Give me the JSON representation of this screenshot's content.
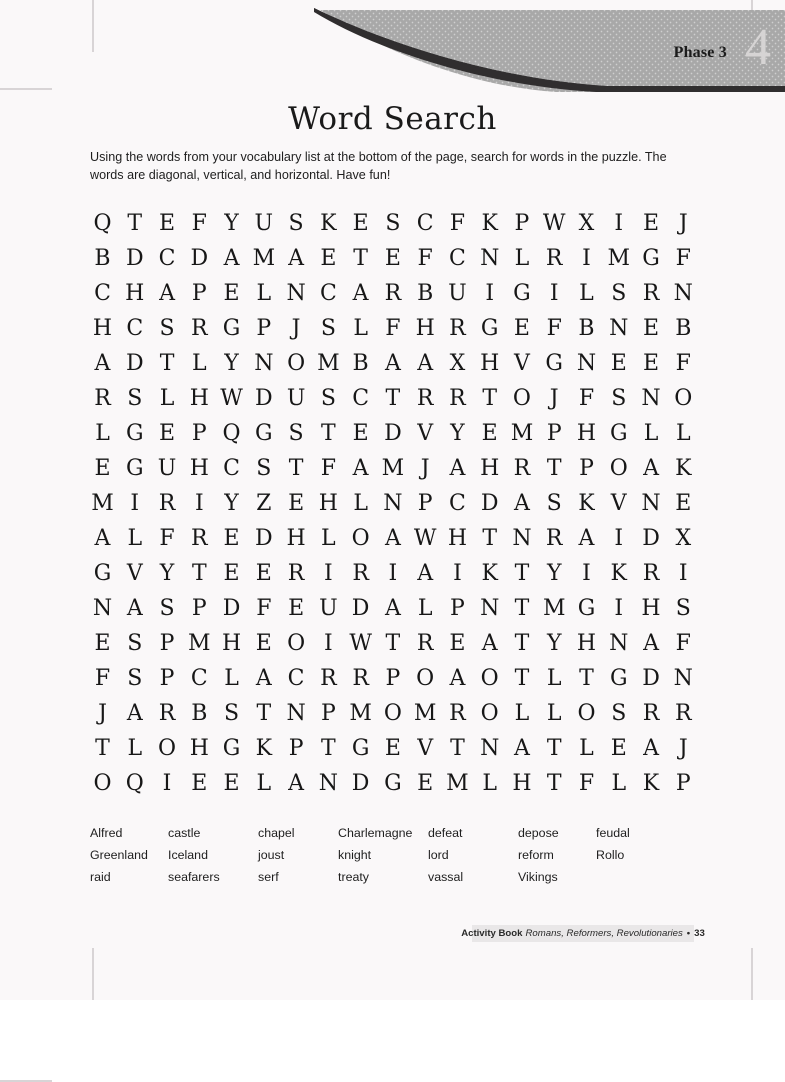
{
  "header": {
    "phase_label": "Phase 3",
    "phase_number": "4",
    "banner_gray": "#a8a8a8",
    "banner_dark": "#302e2f"
  },
  "page": {
    "title": "Word Search",
    "instructions": "Using the words from your vocabulary list at the bottom of the page, search for words in the puzzle. The words are diagonal, vertical, and horizontal. Have fun!"
  },
  "puzzle": {
    "columns": 19,
    "rows": 18,
    "grid": [
      [
        "Q",
        "T",
        "E",
        "F",
        "Y",
        "U",
        "S",
        "K",
        "E",
        "S",
        "C",
        "F",
        "K",
        "P",
        "W",
        "X",
        "I",
        "E",
        "J"
      ],
      [
        "B",
        "D",
        "C",
        "D",
        "A",
        "M",
        "A",
        "E",
        "T",
        "E",
        "F",
        "C",
        "N",
        "L",
        "R",
        "I",
        "M",
        "G",
        "F"
      ],
      [
        "C",
        "H",
        "A",
        "P",
        "E",
        "L",
        "N",
        "C",
        "A",
        "R",
        "B",
        "U",
        "I",
        "G",
        "I",
        "L",
        "S",
        "R",
        "N"
      ],
      [
        "H",
        "C",
        "S",
        "R",
        "G",
        "P",
        "J",
        "S",
        "L",
        "F",
        "H",
        "R",
        "G",
        "E",
        "F",
        "B",
        "N",
        "E",
        "B"
      ],
      [
        "A",
        "D",
        "T",
        "L",
        "Y",
        "N",
        "O",
        "M",
        "B",
        "A",
        "A",
        "X",
        "H",
        "V",
        "G",
        "N",
        "E",
        "E",
        "F"
      ],
      [
        "R",
        "S",
        "L",
        "H",
        "W",
        "D",
        "U",
        "S",
        "C",
        "T",
        "R",
        "R",
        "T",
        "O",
        "J",
        "F",
        "S",
        "N",
        "O"
      ],
      [
        "L",
        "G",
        "E",
        "P",
        "Q",
        "G",
        "S",
        "T",
        "E",
        "D",
        "V",
        "Y",
        "E",
        "M",
        "P",
        "H",
        "G",
        "L",
        "L"
      ],
      [
        "E",
        "G",
        "U",
        "H",
        "C",
        "S",
        "T",
        "F",
        "A",
        "M",
        "J",
        "A",
        "H",
        "R",
        "T",
        "P",
        "O",
        "A",
        "K"
      ],
      [
        "M",
        "I",
        "R",
        "I",
        "Y",
        "Z",
        "E",
        "H",
        "L",
        "N",
        "P",
        "C",
        "D",
        "A",
        "S",
        "K",
        "V",
        "N",
        "E"
      ],
      [
        "A",
        "L",
        "F",
        "R",
        "E",
        "D",
        "H",
        "L",
        "O",
        "A",
        "W",
        "H",
        "T",
        "N",
        "R",
        "A",
        "I",
        "D",
        "X"
      ],
      [
        "G",
        "V",
        "Y",
        "T",
        "E",
        "E",
        "R",
        "I",
        "R",
        "I",
        "A",
        "I",
        "K",
        "T",
        "Y",
        "I",
        "K",
        "R",
        "I"
      ],
      [
        "N",
        "A",
        "S",
        "P",
        "D",
        "F",
        "E",
        "U",
        "D",
        "A",
        "L",
        "P",
        "N",
        "T",
        "M",
        "G",
        "I",
        "H",
        "S"
      ],
      [
        "E",
        "S",
        "P",
        "M",
        "H",
        "E",
        "O",
        "I",
        "W",
        "T",
        "R",
        "E",
        "A",
        "T",
        "Y",
        "H",
        "N",
        "A",
        "F"
      ],
      [
        "F",
        "S",
        "P",
        "C",
        "L",
        "A",
        "C",
        "R",
        "R",
        "P",
        "O",
        "A",
        "O",
        "T",
        "L",
        "T",
        "G",
        "D",
        "N"
      ],
      [
        "J",
        "A",
        "R",
        "B",
        "S",
        "T",
        "N",
        "P",
        "M",
        "O",
        "M",
        "R",
        "O",
        "L",
        "L",
        "O",
        "S",
        "R",
        "R"
      ],
      [
        "T",
        "L",
        "O",
        "H",
        "G",
        "K",
        "P",
        "T",
        "G",
        "E",
        "V",
        "T",
        "N",
        "A",
        "T",
        "L",
        "E",
        "A",
        "J"
      ],
      [
        "O",
        "Q",
        "I",
        "E",
        "E",
        "L",
        "A",
        "N",
        "D",
        "G",
        "E",
        "M",
        "L",
        "H",
        "T",
        "F",
        "L",
        "K",
        "P"
      ]
    ]
  },
  "wordlist": {
    "rows": [
      [
        "Alfred",
        "castle",
        "chapel",
        "Charlemagne",
        "defeat",
        "depose",
        "feudal"
      ],
      [
        "Greenland",
        "Iceland",
        "joust",
        "knight",
        "lord",
        "reform",
        "Rollo"
      ],
      [
        "raid",
        "seafarers",
        "serf",
        "treaty",
        "vassal",
        "Vikings",
        ""
      ]
    ]
  },
  "footer": {
    "book": "Activity Book",
    "series": "Romans, Reformers, Revolutionaries",
    "separator": "•",
    "page_number": "33"
  }
}
